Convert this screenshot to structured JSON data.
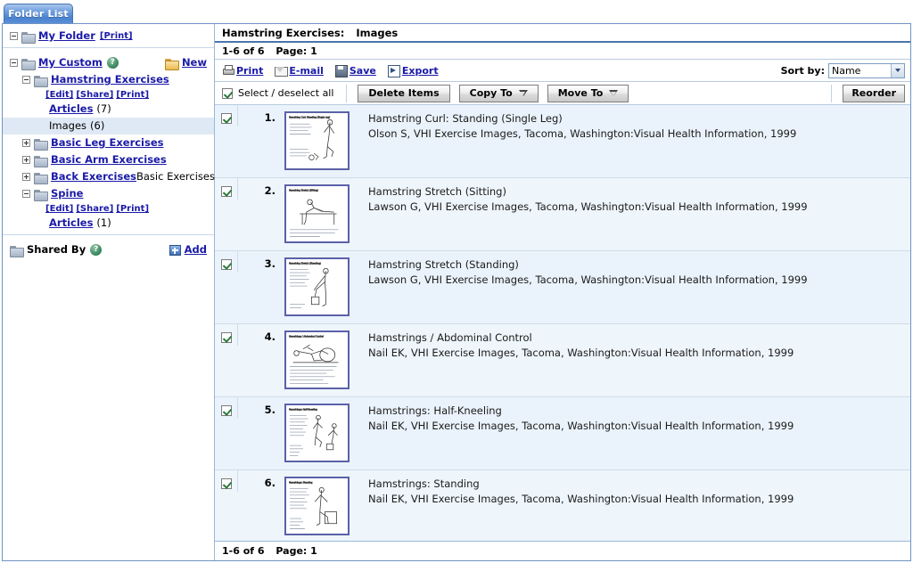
{
  "tab": {
    "label": "Folder List"
  },
  "sidebar": {
    "my_folder": {
      "label": "My Folder",
      "print": "[Print]"
    },
    "my_custom": {
      "label": "My Custom",
      "help_glyph": "?",
      "new_label": "New"
    },
    "folders": [
      {
        "label": "Hamstring Exercises",
        "toggle": "minus",
        "links": [
          "[Edit]",
          "[Share]",
          "[Print]"
        ],
        "children": [
          {
            "label": "Articles",
            "count": "(7)",
            "link": true,
            "selected": false
          },
          {
            "label": "Images",
            "count": "(6)",
            "link": false,
            "selected": true
          }
        ]
      },
      {
        "label": "Basic Leg Exercises",
        "toggle": "plus",
        "suffix": ""
      },
      {
        "label": "Basic Arm Exercises",
        "toggle": "plus",
        "suffix": ""
      },
      {
        "label": "Back Exercises",
        "toggle": "plus",
        "suffix": "Basic Exercises"
      },
      {
        "label": "Spine",
        "toggle": "minus",
        "links": [
          "[Edit]",
          "[Share]",
          "[Print]"
        ],
        "children": [
          {
            "label": "Articles",
            "count": "(1)",
            "link": true,
            "selected": false
          }
        ]
      }
    ],
    "shared_by": {
      "label": "Shared By",
      "help_glyph": "?",
      "add_label": "Add"
    }
  },
  "header": {
    "breadcrumb_folder": "Hamstring Exercises:",
    "breadcrumb_section": "Images",
    "range": "1-6 of 6",
    "page": "Page: 1"
  },
  "toolbar": {
    "print": "Print",
    "email": "E-mail",
    "save": "Save",
    "export": "Export",
    "sort_label": "Sort by:",
    "sort_value": "Name"
  },
  "buttons": {
    "select_all": "Select / deselect all",
    "delete_items": "Delete Items",
    "copy_to": "Copy To",
    "move_to": "Move To",
    "reorder": "Reorder"
  },
  "items": [
    {
      "num": "1.",
      "checked": true,
      "title": "Hamstring Curl: Standing (Single Leg)",
      "citation": "Olson S, VHI Exercise Images, Tacoma, Washington:Visual Health Information, 1999"
    },
    {
      "num": "2.",
      "checked": true,
      "title": "Hamstring Stretch (Sitting)",
      "citation": "Lawson G, VHI Exercise Images, Tacoma, Washington:Visual Health Information, 1999"
    },
    {
      "num": "3.",
      "checked": true,
      "title": "Hamstring Stretch (Standing)",
      "citation": "Lawson G, VHI Exercise Images, Tacoma, Washington:Visual Health Information, 1999"
    },
    {
      "num": "4.",
      "checked": true,
      "title": "Hamstrings / Abdominal Control",
      "citation": "Nail EK, VHI Exercise Images, Tacoma, Washington:Visual Health Information, 1999"
    },
    {
      "num": "5.",
      "checked": true,
      "title": "Hamstrings: Half-Kneeling",
      "citation": "Nail EK, VHI Exercise Images, Tacoma, Washington:Visual Health Information, 1999"
    },
    {
      "num": "6.",
      "checked": true,
      "title": "Hamstrings: Standing",
      "citation": "Nail EK, VHI Exercise Images, Tacoma, Washington:Visual Health Information, 1999"
    }
  ],
  "footer": {
    "range": "1-6 of 6",
    "page": "Page: 1"
  },
  "colors": {
    "tab_blue": "#4a82cf",
    "link_blue": "#1a1aa8",
    "row_bg": "#eaf3fb",
    "panel_border": "#6f93c4",
    "thumb_border": "#5b61a8",
    "check_green": "#2d7a3e"
  }
}
